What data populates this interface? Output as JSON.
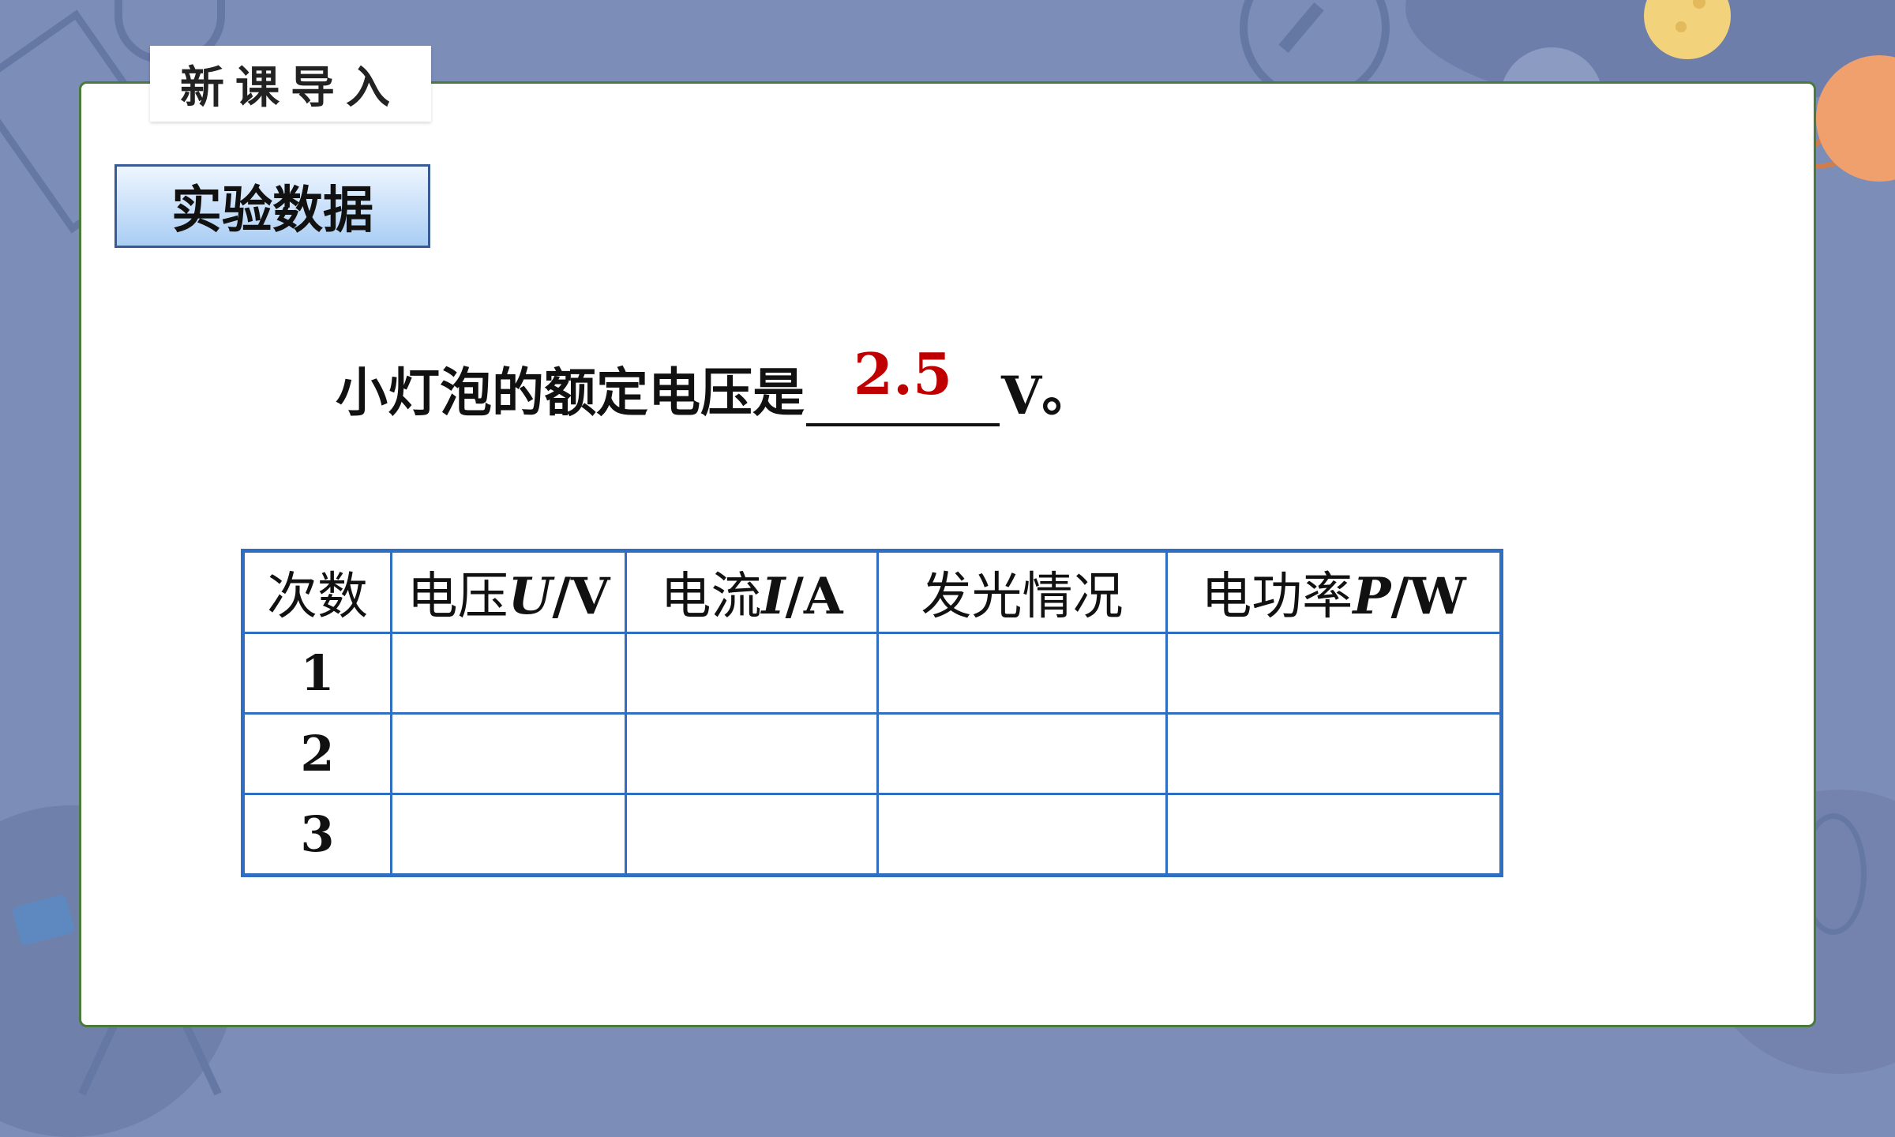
{
  "header": {
    "lesson_tab": "新课导入"
  },
  "section": {
    "title": "实验数据"
  },
  "question": {
    "prefix": "小灯泡的额定电压是",
    "answer": "2.5",
    "unit": "V",
    "suffix": "。"
  },
  "table": {
    "headers": [
      {
        "text": "次数"
      },
      {
        "text": "电压",
        "symbol": "U",
        "unit": "/V"
      },
      {
        "text": "电流",
        "symbol": "I",
        "unit": "/A"
      },
      {
        "text": "发光情况"
      },
      {
        "text": "电功率",
        "symbol": "P",
        "unit": "/W"
      }
    ],
    "rows": [
      {
        "index": "1"
      },
      {
        "index": "2"
      },
      {
        "index": "3"
      }
    ]
  },
  "colors": {
    "answer": "#c00000",
    "table_border": "#2f6ec0",
    "background": "#7c8db7"
  }
}
